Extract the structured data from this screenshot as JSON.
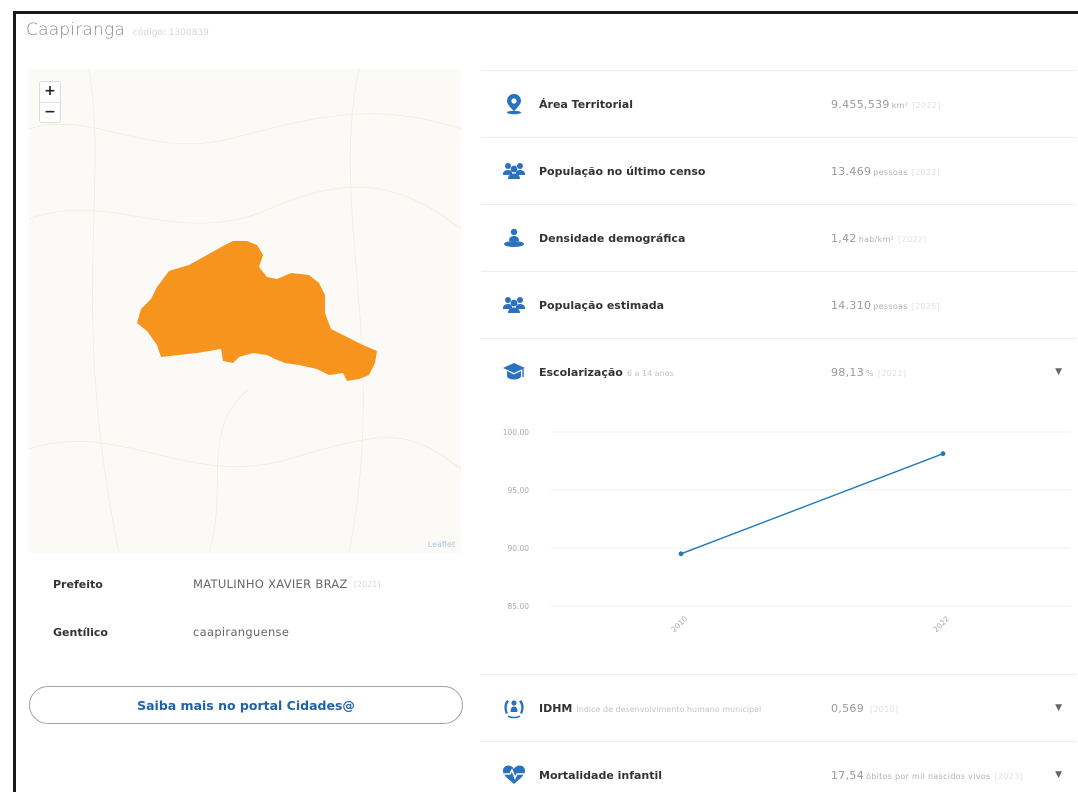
{
  "header": {
    "city": "Caapiranga",
    "code": "código: 1300839"
  },
  "map": {
    "zoom_in": "+",
    "zoom_out": "−",
    "attribution": "Leaflet",
    "fill_color": "#f7941d"
  },
  "info": [
    {
      "label": "Prefeito",
      "value": "MATULINHO XAVIER BRAZ",
      "year": "[2021]"
    },
    {
      "label": "Gentílico",
      "value": "caapiranguense",
      "year": ""
    }
  ],
  "portal_button": "Saiba mais no portal Cidades@",
  "indicators": [
    {
      "icon": "location-pin-icon",
      "label": "Área Territorial",
      "sub": "",
      "value": "9.455,539",
      "unit": "km²",
      "year": "[2022]",
      "expandable": false
    },
    {
      "icon": "people-group-icon",
      "label": "População no último censo",
      "sub": "",
      "value": "13.469",
      "unit": "pessoas",
      "year": "[2022]",
      "expandable": false
    },
    {
      "icon": "density-icon",
      "label": "Densidade demográfica",
      "sub": "",
      "value": "1,42",
      "unit": "hab/km²",
      "year": "[2022]",
      "expandable": false
    },
    {
      "icon": "people-group-icon",
      "label": "População estimada",
      "sub": "",
      "value": "14.310",
      "unit": "pessoas",
      "year": "[2025]",
      "expandable": false
    },
    {
      "icon": "graduation-cap-icon",
      "label": "Escolarização",
      "sub": "6 a 14 anos",
      "value": "98,13",
      "unit": "%",
      "year": "[2022]",
      "expandable": true
    },
    {
      "icon": "idhm-icon",
      "label": "IDHM",
      "sub": "Índice de desenvolvimento humano municipal",
      "value": "0,569",
      "unit": "",
      "year": "[2010]",
      "expandable": true
    },
    {
      "icon": "heart-monitor-icon",
      "label": "Mortalidade infantil",
      "sub": "",
      "value": "17,54",
      "unit": "óbitos por mil nascidos vivos",
      "year": "[2023]",
      "expandable": true
    }
  ],
  "chart_data": {
    "type": "line",
    "x": [
      "2010",
      "2022"
    ],
    "series": [
      {
        "values": [
          89.5,
          98.13
        ]
      }
    ],
    "yticks": [
      "100.00",
      "95.00",
      "90.00",
      "85.00"
    ],
    "ylim": [
      85,
      100
    ],
    "grid": true,
    "color": "#1f7ab8"
  }
}
